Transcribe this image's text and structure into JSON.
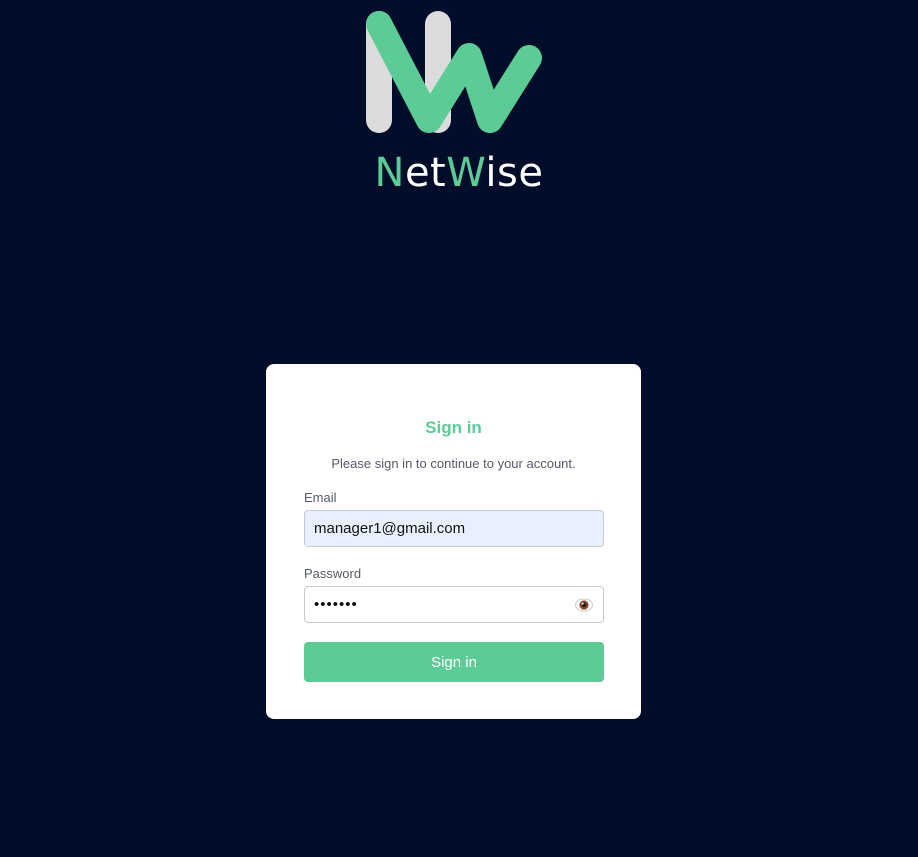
{
  "brand": {
    "name_parts": [
      "N",
      "et",
      "W",
      "ise"
    ],
    "accent_color": "#5ccc96",
    "logo_icon": "netwise-logo-icon"
  },
  "login": {
    "title": "Sign in",
    "subtitle": "Please sign in to continue to your account.",
    "email_label": "Email",
    "email_value": "manager1@gmail.com",
    "password_label": "Password",
    "password_value": "•••••••",
    "toggle_icon": "eye-icon",
    "submit_label": "Sign in"
  },
  "colors": {
    "background": "#020d2a",
    "card": "#ffffff",
    "accent": "#5ccc96",
    "autofill_bg": "#e8f0fe"
  }
}
